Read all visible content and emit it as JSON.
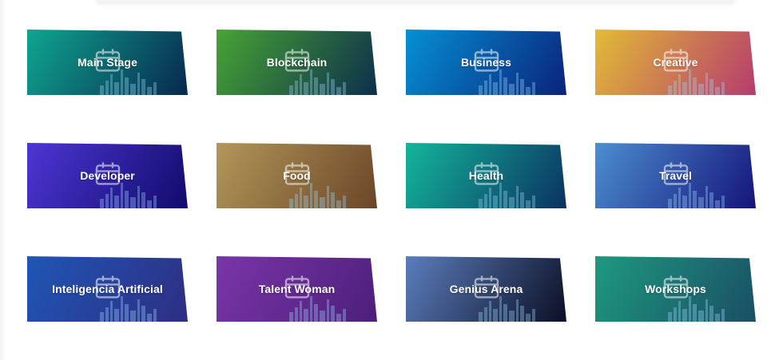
{
  "categories": [
    {
      "label": "Main Stage",
      "color_start": "#0fa58f",
      "color_end": "#08284f"
    },
    {
      "label": "Blockchain",
      "color_start": "#47a334",
      "color_end": "#0d2f4c"
    },
    {
      "label": "Business",
      "color_start": "#0590d4",
      "color_end": "#0a237b"
    },
    {
      "label": "Creative",
      "color_start": "#e2bb36",
      "color_end": "#b63b6e"
    },
    {
      "label": "Developer",
      "color_start": "#4c36d4",
      "color_end": "#120b6c"
    },
    {
      "label": "Food",
      "color_start": "#b2975a",
      "color_end": "#6b4627"
    },
    {
      "label": "Health",
      "color_start": "#14b59b",
      "color_end": "#0b3260"
    },
    {
      "label": "Travel",
      "color_start": "#4c8ed0",
      "color_end": "#15147a"
    },
    {
      "label": "Inteligencia Artificial",
      "color_start": "#1f56b5",
      "color_end": "#2e2d83"
    },
    {
      "label": "Talent Woman",
      "color_start": "#7a35a8",
      "color_end": "#4c1f7a"
    },
    {
      "label": "Genius Arena",
      "color_start": "#5b7dbd",
      "color_end": "#0b0f24"
    },
    {
      "label": "Workshops",
      "color_start": "#1e9980",
      "color_end": "#1a4e64"
    }
  ],
  "icons": {
    "card_icon": "calendar-icon",
    "card_background": "city-skyline-icon"
  }
}
